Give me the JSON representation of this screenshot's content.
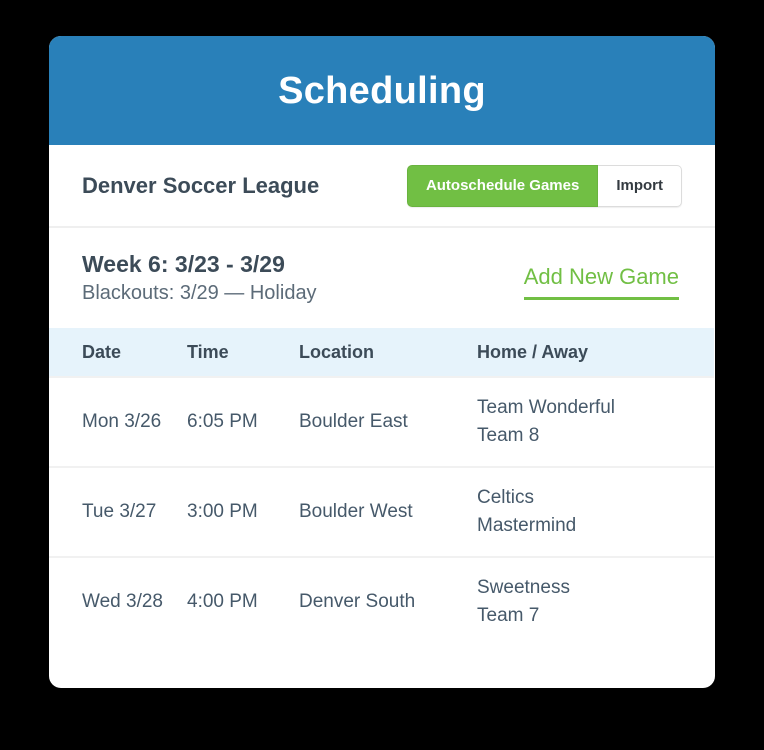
{
  "window": {
    "title": "Scheduling"
  },
  "league": {
    "name": "Denver Soccer League",
    "autoschedule_label": "Autoschedule Games",
    "import_label": "Import"
  },
  "week": {
    "title": "Week 6: 3/23 - 3/29",
    "blackouts": "Blackouts: 3/29 — Holiday",
    "add_game_label": "Add New Game"
  },
  "table": {
    "columns": [
      "Date",
      "Time",
      "Location",
      "Home / Away"
    ],
    "rows": [
      {
        "date": "Mon 3/26",
        "time": "6:05 PM",
        "location": "Boulder East",
        "home": "Team Wonderful",
        "away": "Team 8"
      },
      {
        "date": "Tue 3/27",
        "time": "3:00 PM",
        "location": "Boulder West",
        "home": "Celtics",
        "away": "Mastermind"
      },
      {
        "date": "Wed 3/28",
        "time": "4:00 PM",
        "location": "Denver South",
        "home": "Sweetness",
        "away": "Team 7"
      }
    ]
  },
  "colors": {
    "header_blue": "#2980b9",
    "accent_green": "#71bf44",
    "table_header_blue": "#e6f3fb",
    "text_dark": "#3c4b58",
    "text_body": "#46596a",
    "background": "#000000"
  }
}
